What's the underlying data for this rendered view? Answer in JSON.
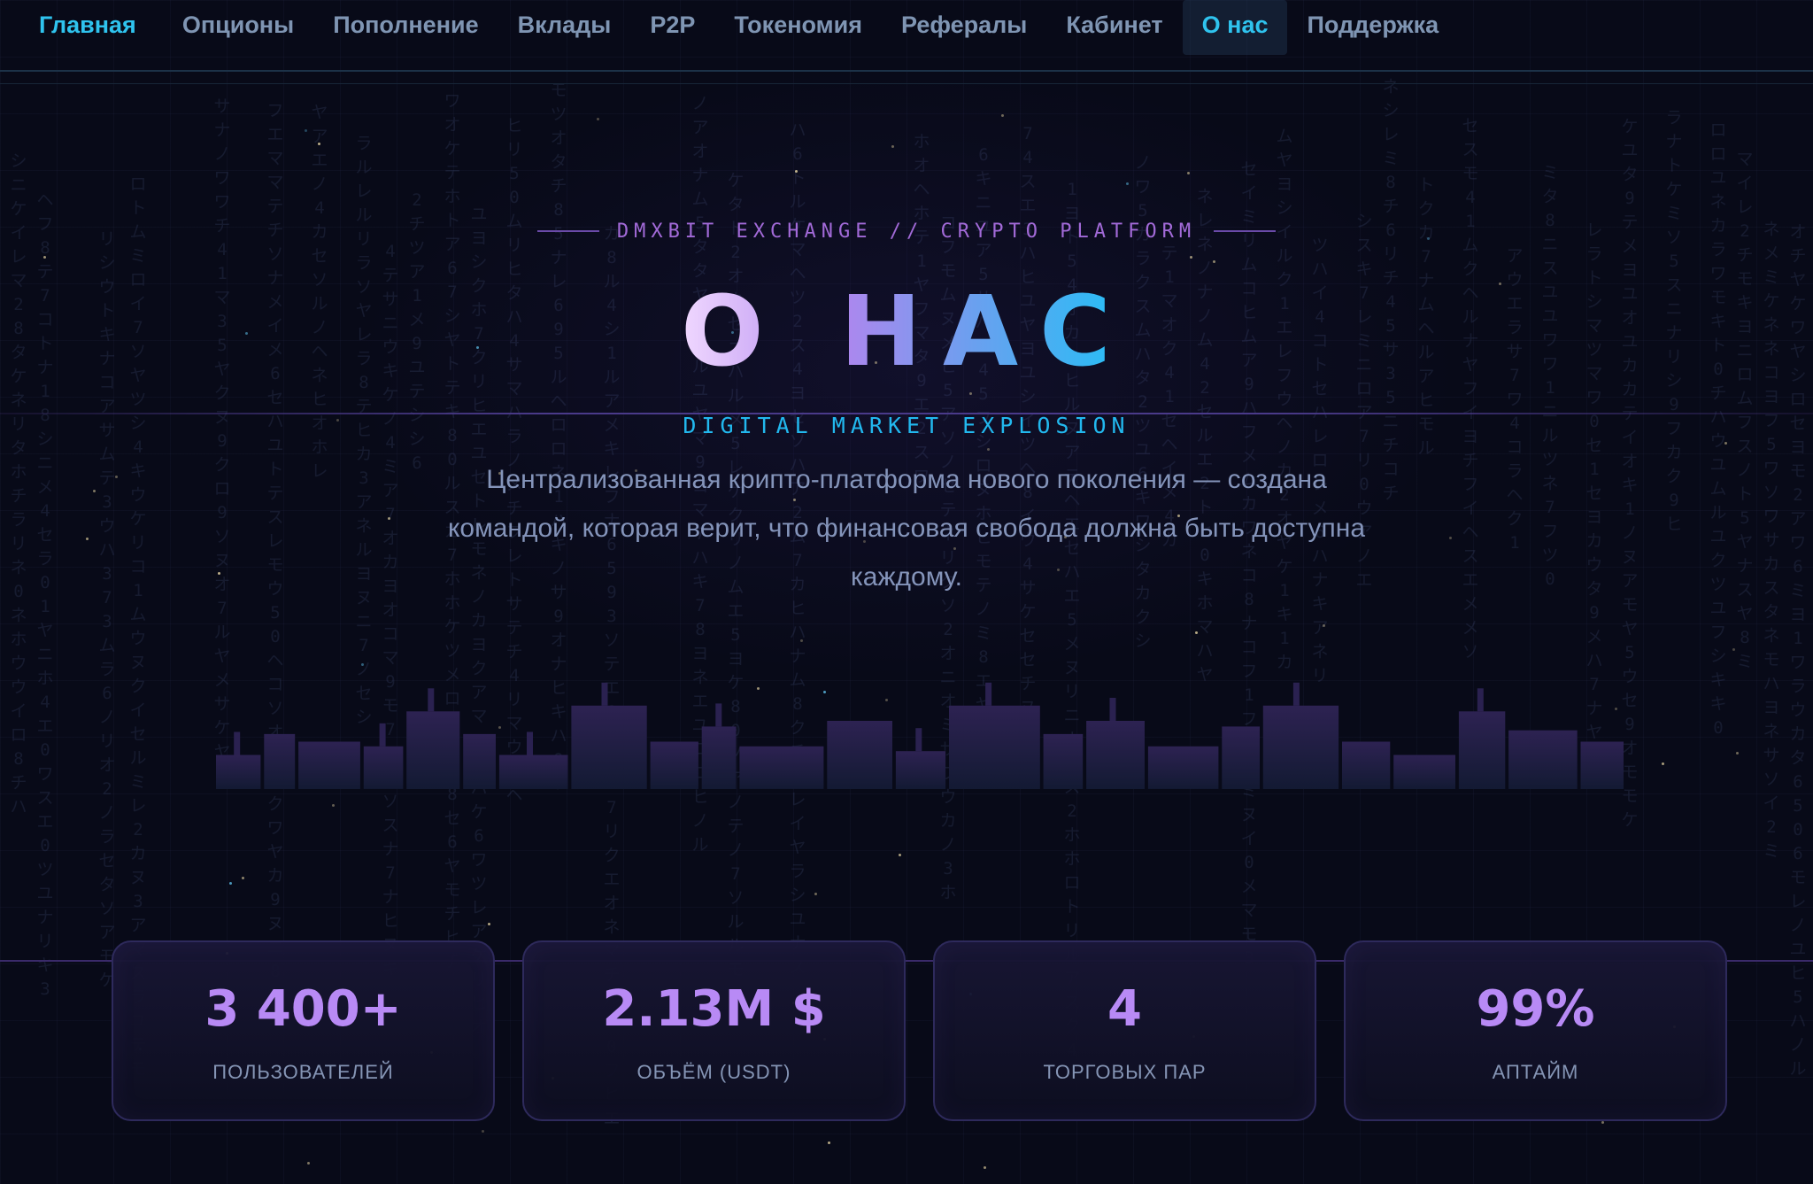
{
  "nav": {
    "items": [
      {
        "label": "Главная",
        "name": "nav-home"
      },
      {
        "label": "Опционы",
        "name": "nav-options"
      },
      {
        "label": "Пополнение",
        "name": "nav-deposit"
      },
      {
        "label": "Вклады",
        "name": "nav-savings"
      },
      {
        "label": "P2P",
        "name": "nav-p2p"
      },
      {
        "label": "Токеномия",
        "name": "nav-tokenomics"
      },
      {
        "label": "Рефералы",
        "name": "nav-referrals"
      },
      {
        "label": "Кабинет",
        "name": "nav-cabinet"
      },
      {
        "label": "О нас",
        "name": "nav-about"
      },
      {
        "label": "Поддержка",
        "name": "nav-support"
      }
    ],
    "active": "О нас",
    "accent_color": "#2fc3ee"
  },
  "hero": {
    "eyebrow": "DMXBIT EXCHANGE // CRYPTO PLATFORM",
    "title": "О НАС",
    "subtitle": "DIGITAL MARKET EXPLOSION",
    "description": "Централизованная крипто-платформа нового поколения — создана командой, которая верит, что финансовая свобода должна быть доступна каждому."
  },
  "decorative_bars": {
    "bar_heights_relative": [
      0.36,
      0.58,
      0.5,
      0.45,
      0.82,
      0.58,
      0.36,
      0.88,
      0.5,
      0.66,
      0.45,
      0.72,
      0.4,
      0.88,
      0.58,
      0.72,
      0.45,
      0.66,
      0.88,
      0.5,
      0.36,
      0.82,
      0.62,
      0.5
    ],
    "color": "#2a2150"
  },
  "stats": [
    {
      "value": "3 400+",
      "label": "ПОЛЬЗОВАТЕЛЕЙ"
    },
    {
      "value": "2.13M $",
      "label": "ОБЪЁМ (USDT)"
    },
    {
      "value": "4",
      "label": "ТОРГОВЫХ ПАР"
    },
    {
      "value": "99%",
      "label": "АПТАЙМ"
    }
  ],
  "colors": {
    "background": "#080a18",
    "stat_value": "#b88af5",
    "subtitle": "#22b8ee",
    "eyebrow": "#a26ad8"
  }
}
